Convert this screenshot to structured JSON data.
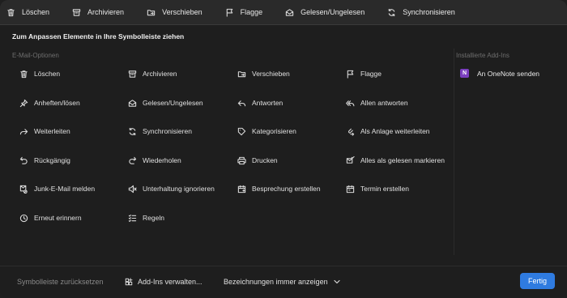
{
  "toolbar": {
    "items": [
      {
        "label": "Löschen",
        "icon": "trash-icon"
      },
      {
        "label": "Archivieren",
        "icon": "archive-icon"
      },
      {
        "label": "Verschieben",
        "icon": "move-folder-icon"
      },
      {
        "label": "Flagge",
        "icon": "flag-icon"
      },
      {
        "label": "Gelesen/Ungelesen",
        "icon": "envelope-icon"
      },
      {
        "label": "Synchronisieren",
        "icon": "sync-icon"
      }
    ]
  },
  "dialog": {
    "subtitle": "Zum Anpassen Elemente in Ihre Symbolleiste ziehen",
    "email_options_label": "E-Mail-Optionen",
    "installed_addins_label": "Installierte Add-Ins"
  },
  "options": [
    {
      "label": "Löschen",
      "icon": "trash-icon"
    },
    {
      "label": "Archivieren",
      "icon": "archive-icon"
    },
    {
      "label": "Verschieben",
      "icon": "move-folder-icon"
    },
    {
      "label": "Flagge",
      "icon": "flag-icon"
    },
    {
      "label": "Anheften/lösen",
      "icon": "pin-icon"
    },
    {
      "label": "Gelesen/Ungelesen",
      "icon": "envelope-icon"
    },
    {
      "label": "Antworten",
      "icon": "reply-icon"
    },
    {
      "label": "Allen antworten",
      "icon": "reply-all-icon"
    },
    {
      "label": "Weiterleiten",
      "icon": "forward-icon"
    },
    {
      "label": "Synchronisieren",
      "icon": "sync-icon"
    },
    {
      "label": "Kategorisieren",
      "icon": "tag-icon"
    },
    {
      "label": "Als Anlage weiterleiten",
      "icon": "forward-attachment-icon"
    },
    {
      "label": "Rückgängig",
      "icon": "undo-icon"
    },
    {
      "label": "Wiederholen",
      "icon": "redo-icon"
    },
    {
      "label": "Drucken",
      "icon": "printer-icon"
    },
    {
      "label": "Alles als gelesen markieren",
      "icon": "mark-all-read-icon"
    },
    {
      "label": "Junk-E-Mail melden",
      "icon": "junk-mail-icon"
    },
    {
      "label": "Unterhaltung ignorieren",
      "icon": "mute-icon"
    },
    {
      "label": "Besprechung erstellen",
      "icon": "meeting-icon"
    },
    {
      "label": "Termin erstellen",
      "icon": "calendar-icon"
    },
    {
      "label": "Erneut erinnern",
      "icon": "clock-icon"
    },
    {
      "label": "Regeln",
      "icon": "rules-icon"
    }
  ],
  "addins": [
    {
      "label": "An OneNote senden",
      "icon": "onenote-icon",
      "badge": "N"
    }
  ],
  "footer": {
    "reset_label": "Symbolleiste zurücksetzen",
    "manage_addins_label": "Add-Ins verwalten...",
    "labels_mode_label": "Bezeichnungen immer anzeigen",
    "done_label": "Fertig"
  },
  "colors": {
    "background": "#1e1e1e",
    "toolbar": "#2a2a2a",
    "accent": "#2f7be0",
    "onenote": "#7b3fbf"
  }
}
